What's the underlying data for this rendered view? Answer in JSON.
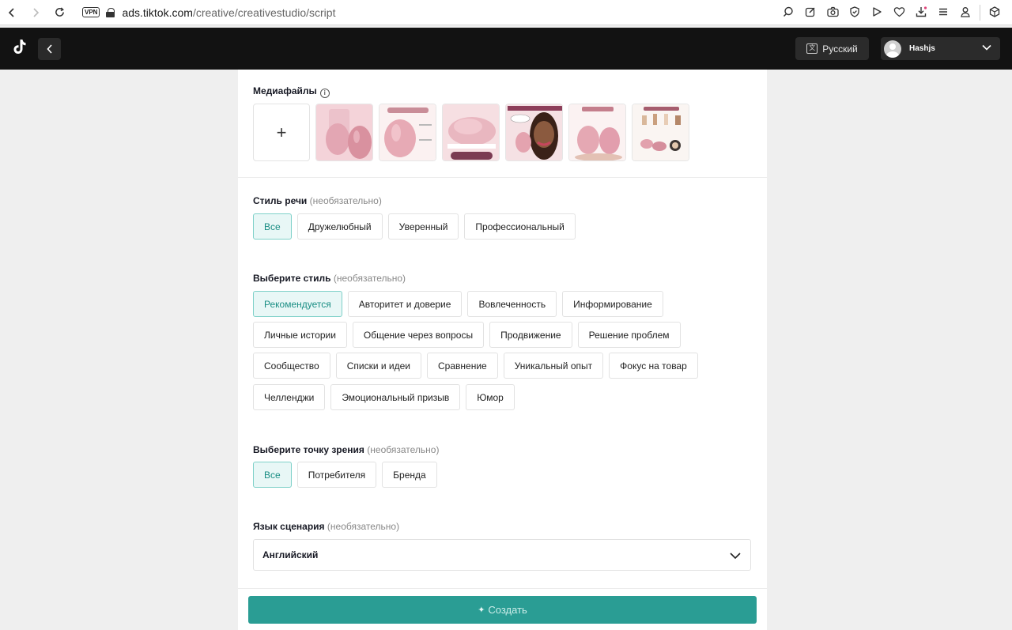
{
  "browser": {
    "vpn_label": "VPN",
    "url_host": "ads.tiktok.com",
    "url_path": "/creative/creativestudio/script"
  },
  "header": {
    "language_label": "Русский",
    "user_name": "Hashjs"
  },
  "media": {
    "label": "Медиафайлы",
    "add_symbol": "+",
    "thumbnails": [
      "thumb-1",
      "thumb-2",
      "thumb-3",
      "thumb-4",
      "thumb-5",
      "thumb-6"
    ]
  },
  "speech_style": {
    "label": "Стиль речи",
    "optional": "(необязательно)",
    "options": [
      "Все",
      "Дружелюбный",
      "Уверенный",
      "Профессиональный"
    ],
    "selected": "Все"
  },
  "style": {
    "label": "Выберите стиль",
    "optional": "(необязательно)",
    "rows": [
      [
        "Рекомендуется",
        "Авторитет и доверие",
        "Вовлеченность",
        "Информирование"
      ],
      [
        "Личные истории",
        "Общение через вопросы",
        "Продвижение",
        "Решение проблем"
      ],
      [
        "Сообщество",
        "Списки и идеи",
        "Сравнение",
        "Уникальный опыт",
        "Фокус на товар"
      ],
      [
        "Челленджи",
        "Эмоциональный призыв",
        "Юмор"
      ]
    ],
    "selected": "Рекомендуется"
  },
  "viewpoint": {
    "label": "Выберите точку зрения",
    "optional": "(необязательно)",
    "options": [
      "Все",
      "Потребителя",
      "Бренда"
    ],
    "selected": "Все"
  },
  "script_language": {
    "label": "Язык сценария",
    "optional": "(необязательно)",
    "value": "Английский"
  },
  "create_button": {
    "label": "Создать"
  },
  "colors": {
    "accent": "#2a9d94",
    "chip_active_bg": "#e8f7f6",
    "header_bg": "#121212"
  }
}
